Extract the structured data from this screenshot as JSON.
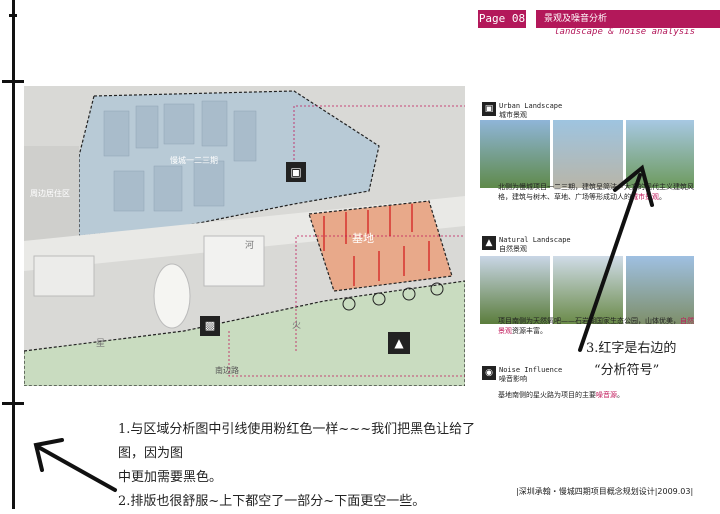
{
  "header": {
    "page": "Page 08",
    "title": "景观及噪音分析",
    "subtitle": "landscape & noise analysis"
  },
  "map": {
    "labels": {
      "nearby_residential": "周边居住区",
      "mancheng_phase": "慢城一二三期",
      "site": "基地",
      "row_village": "南边路",
      "road_river": "河",
      "road_fire": "火",
      "road_star": "星"
    },
    "icons": [
      "building-icon",
      "mountain-icon",
      "bus-icon",
      "noise-icon"
    ]
  },
  "panels": [
    {
      "icon": "building-icon",
      "title_en": "Urban Landscape",
      "title_cn": "城市景观",
      "caption_a": "北侧为慢城项目一二三期，建筑呈简洁、大方的现代主义建筑风格，建筑与树木、草地、广场等形成动人的",
      "caption_hl": "城市景观",
      "caption_b": "。"
    },
    {
      "icon": "mountain-icon",
      "title_en": "Natural Landscape",
      "title_cn": "自然景观",
      "caption_a": "项目南侧为天然氧吧——石岩湖国家生态公园，山体优美，",
      "caption_hl": "自然景观",
      "caption_b": "资源丰富。"
    },
    {
      "icon": "noise-icon",
      "title_en": "Noise Influence",
      "title_cn": "噪音影响",
      "caption_a": "基地南侧的星火路为项目的主要",
      "caption_hl": "噪音源",
      "caption_b": "。"
    }
  ],
  "notes": {
    "line1": "1.与区域分析图中引线使用粉红色一样~~~我们把黑色让给了图，因为图",
    "line1b": "中更加需要黑色。",
    "line2": "2.排版也很舒服~上下都空了一部分~下面更空一些。",
    "line3a": "3.红字是右边的",
    "line3b": "“分析符号”"
  },
  "footer": "|深圳承翰・慢城四期项目概念规划设计|2009.03|",
  "colors": {
    "accent": "#b3185a",
    "site_fill": "#e8a98a",
    "north_fill": "#b8cad6",
    "south_fill": "#c9dcc0"
  }
}
